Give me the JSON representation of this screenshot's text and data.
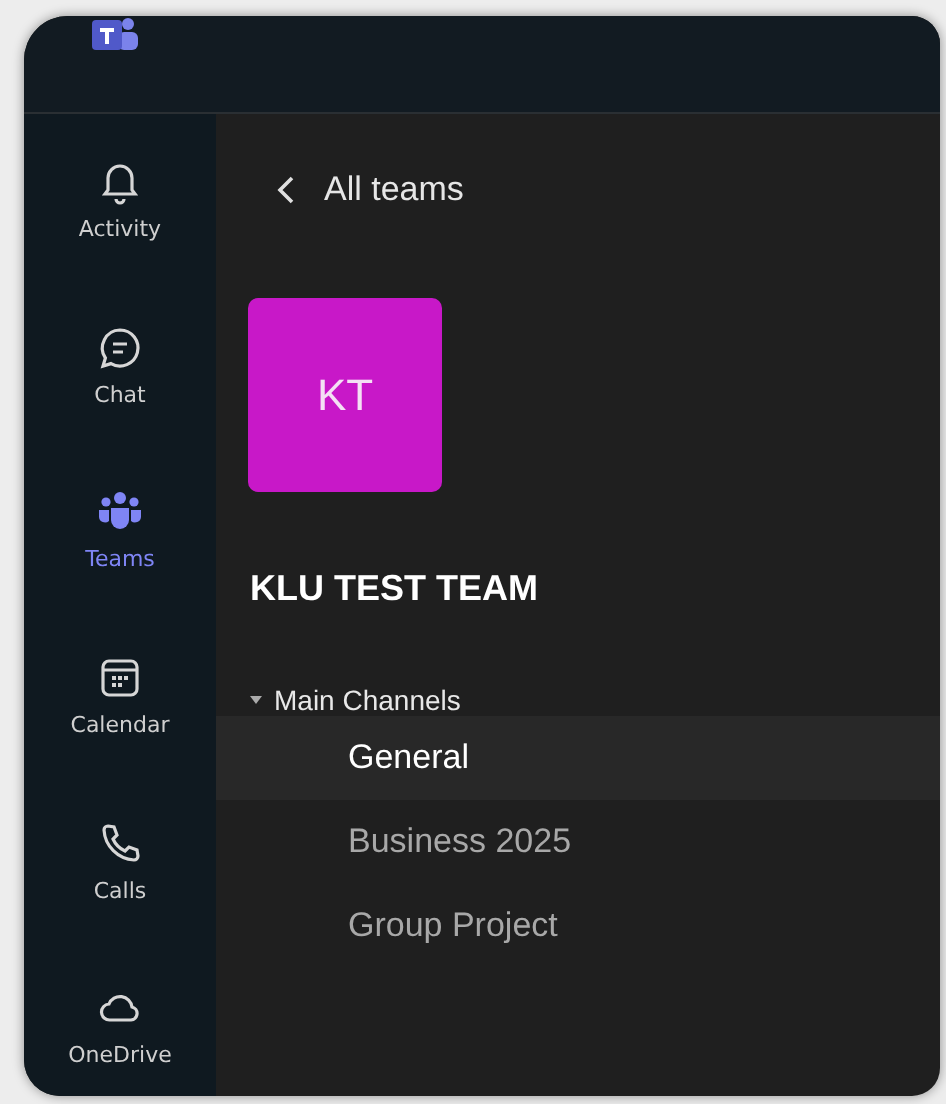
{
  "app_bar": [
    {
      "label": "Activity",
      "selected": false
    },
    {
      "label": "Chat",
      "selected": false
    },
    {
      "label": "Teams",
      "selected": true
    },
    {
      "label": "Calendar",
      "selected": false
    },
    {
      "label": "Calls",
      "selected": false
    },
    {
      "label": "OneDrive",
      "selected": false
    }
  ],
  "back_link": {
    "label": "All teams"
  },
  "team": {
    "initials": "KT",
    "name": "KLU TEST TEAM"
  },
  "channel_group": {
    "label": "Main Channels",
    "expanded": true,
    "channels": [
      {
        "name": "General",
        "selected": true
      },
      {
        "name": "Business 2025",
        "selected": false
      },
      {
        "name": "Group Project",
        "selected": false
      }
    ]
  }
}
